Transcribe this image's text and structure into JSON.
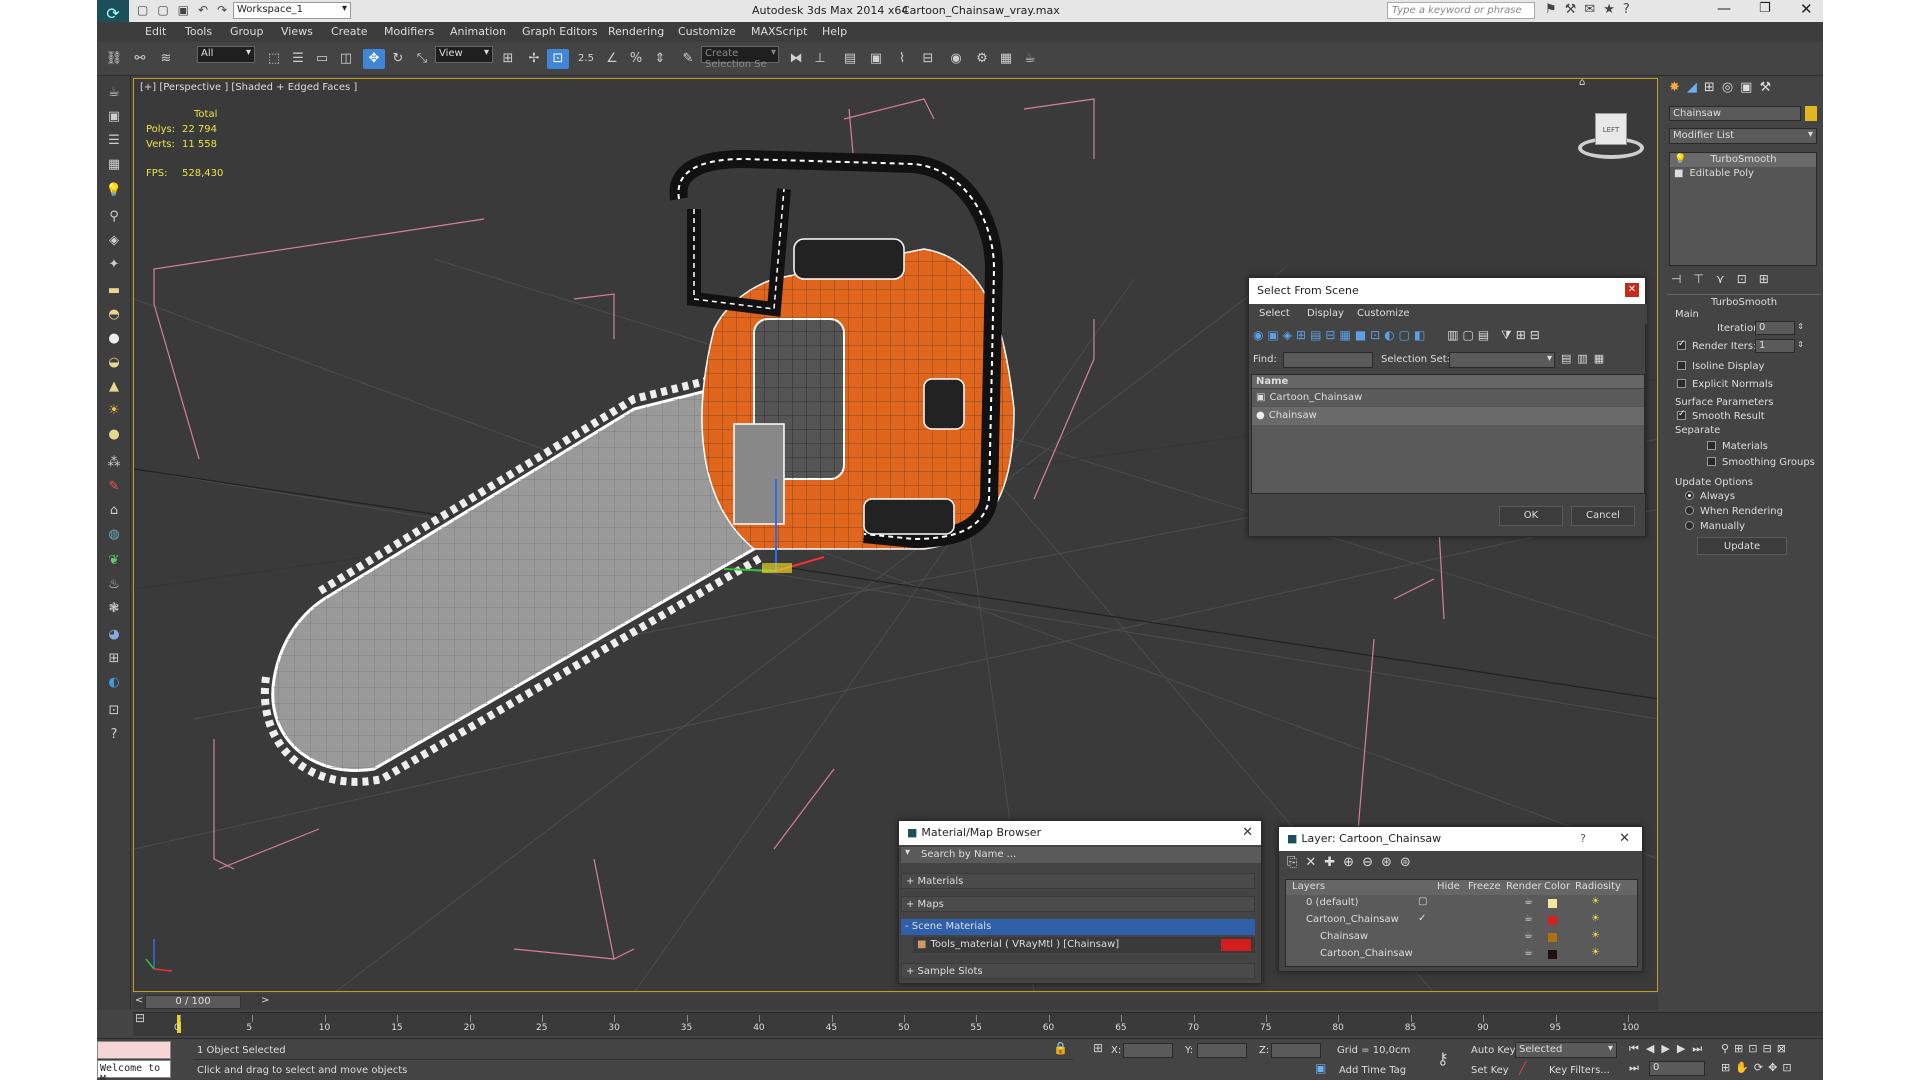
{
  "title": {
    "app": "Autodesk 3ds Max  2014 x64",
    "file": "Cartoon_Chainsaw_vray.max",
    "workspace": "Workspace_1",
    "search_placeholder": "Type a keyword or phrase"
  },
  "menu": [
    "Edit",
    "Tools",
    "Group",
    "Views",
    "Create",
    "Modifiers",
    "Animation",
    "Graph Editors",
    "Rendering",
    "Customize",
    "MAXScript",
    "Help"
  ],
  "toolbar": {
    "filter": "All",
    "refcoord": "View",
    "snap_label": "2.5",
    "selset": "Create Selection Se"
  },
  "viewport": {
    "label": "[+] [Perspective ] [Shaded + Edged Faces ]",
    "stats": {
      "total_label": "Total",
      "polys_label": "Polys:",
      "polys": "22 794",
      "verts_label": "Verts:",
      "verts": "11 558",
      "fps_label": "FPS:",
      "fps": "528,430"
    },
    "viewcube": "LEFT"
  },
  "right_panel": {
    "object_name": "Chainsaw",
    "modifier_list": "Modifier List",
    "stack": [
      "TurboSmooth",
      "Editable Poly"
    ],
    "rollout": "TurboSmooth",
    "main": "Main",
    "iterations_label": "Iterations:",
    "iterations": "0",
    "render_iters_label": "Render Iters:",
    "render_iters": "1",
    "isoline": "Isoline Display",
    "explicit": "Explicit Normals",
    "surface": "Surface Parameters",
    "smooth_result": "Smooth Result",
    "separate": "Separate",
    "materials": "Materials",
    "smoothing_groups": "Smoothing Groups",
    "update_options": "Update Options",
    "always": "Always",
    "when_rendering": "When Rendering",
    "manually": "Manually",
    "update_btn": "Update"
  },
  "select_dialog": {
    "title": "Select From Scene",
    "menu": [
      "Select",
      "Display",
      "Customize"
    ],
    "find_label": "Find:",
    "selset_label": "Selection Set:",
    "name_header": "Name",
    "items": [
      "Cartoon_Chainsaw",
      "Chainsaw"
    ],
    "ok": "OK",
    "cancel": "Cancel"
  },
  "material_browser": {
    "title": "Material/Map Browser",
    "search": "Search by Name ...",
    "sections": [
      "+ Materials",
      "+ Maps",
      "- Scene Materials",
      "+ Sample Slots"
    ],
    "material": "Tools_material  ( VRayMtl ) [Chainsaw]"
  },
  "layer_dialog": {
    "title": "Layer: Cartoon_Chainsaw",
    "headers": [
      "Layers",
      "Hide",
      "Freeze",
      "Render",
      "Color",
      "Radiosity"
    ],
    "rows": [
      {
        "name": "0 (default)",
        "color": "#f0e6a0"
      },
      {
        "name": "Cartoon_Chainsaw",
        "color": "#d42020"
      },
      {
        "name": "Chainsaw",
        "color": "#b07010"
      },
      {
        "name": "Cartoon_Chainsaw",
        "color": "#201010"
      }
    ]
  },
  "timeline": {
    "frame": "0 / 100",
    "ticks": [
      "0",
      "5",
      "10",
      "15",
      "20",
      "25",
      "30",
      "35",
      "40",
      "45",
      "50",
      "55",
      "60",
      "65",
      "70",
      "75",
      "80",
      "85",
      "90",
      "95",
      "100"
    ]
  },
  "status": {
    "script": "Welcome to M",
    "selected": "1 Object Selected",
    "prompt": "Click and drag to select and move objects",
    "x": "X:",
    "y": "Y:",
    "z": "Z:",
    "grid": "Grid = 10,0cm",
    "add_time_tag": "Add Time Tag",
    "auto_key": "Auto Key",
    "selected_combo": "Selected",
    "set_key": "Set Key",
    "key_filters": "Key Filters...",
    "frame": "0"
  }
}
